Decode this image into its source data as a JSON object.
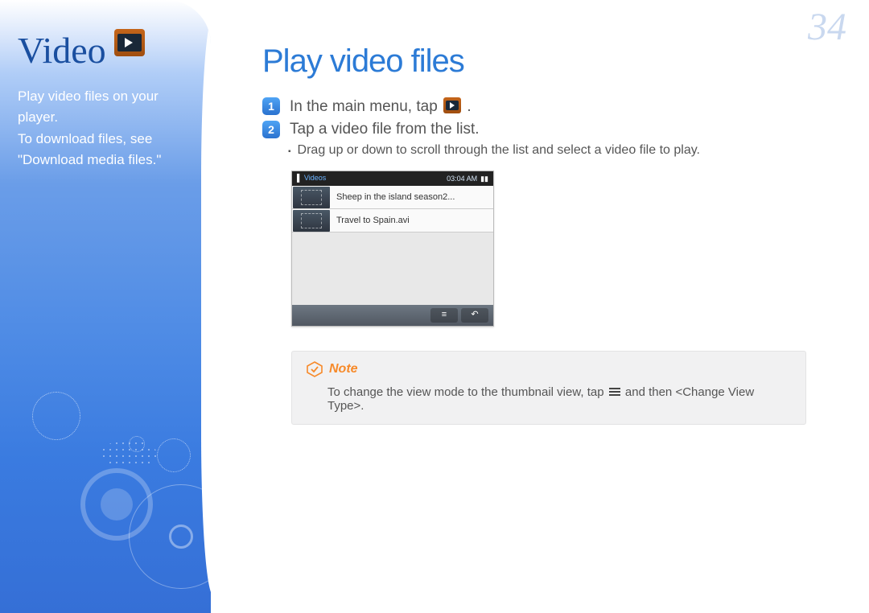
{
  "page_number": "34",
  "sidebar": {
    "title": "Video",
    "desc_line1": "Play video files on your player.",
    "desc_line2": "To download files, see \"Download media files.\""
  },
  "main": {
    "heading": "Play video files",
    "steps": [
      {
        "num": "1",
        "text_before_icon": "In the main menu, tap ",
        "text_after_icon": "."
      },
      {
        "num": "2",
        "text": "Tap a video file from the list."
      }
    ],
    "sub_bullet": "Drag up or down to scroll through the list and select a video file to play."
  },
  "device": {
    "statusbar": {
      "title": "Videos",
      "time": "03:04 AM"
    },
    "rows": [
      "Sheep in the island season2...",
      "Travel to Spain.avi"
    ],
    "footer_buttons": {
      "menu": "≡",
      "back": "↶"
    }
  },
  "note": {
    "label": "Note",
    "text_before": "To change the view mode to the thumbnail view, tap ",
    "text_after": " and then <Change View Type>."
  }
}
